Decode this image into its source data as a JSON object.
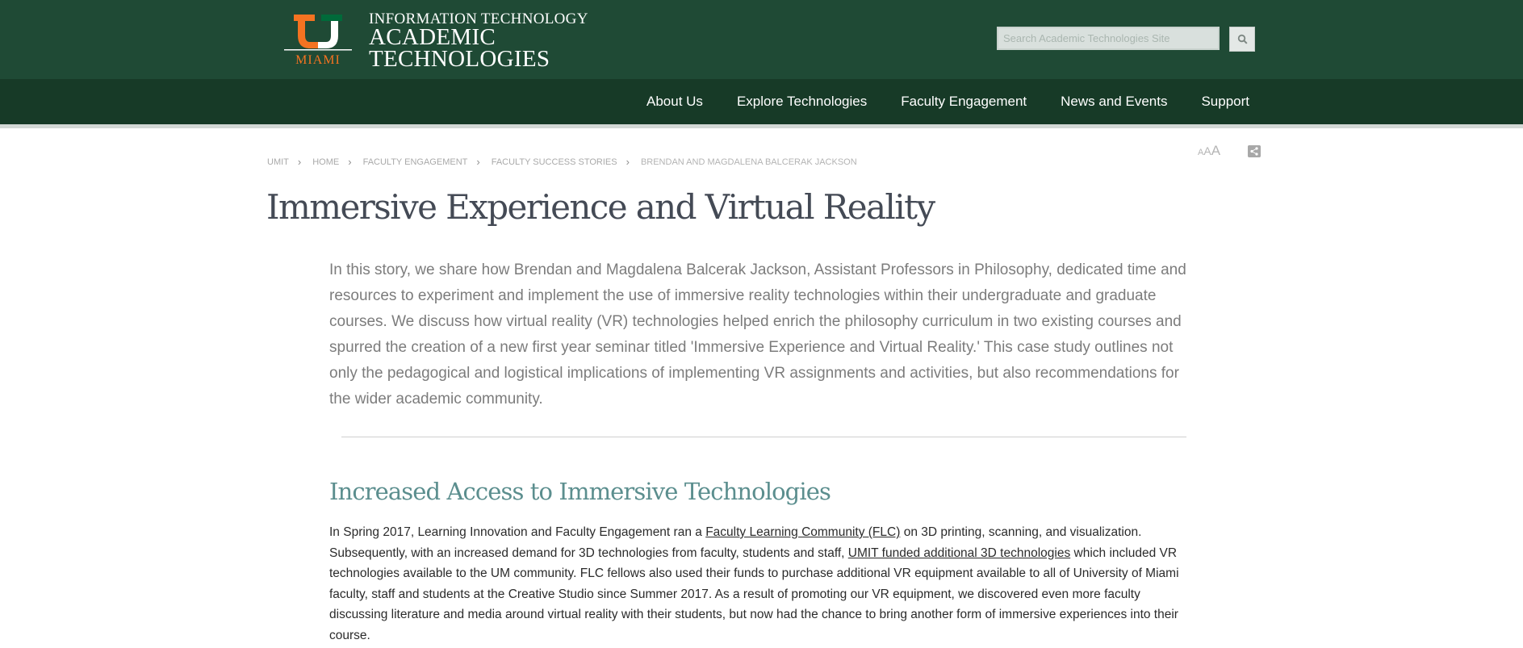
{
  "header": {
    "logo_text": "MIAMI",
    "brand_line1": "INFORMATION TECHNOLOGY",
    "brand_line2": "ACADEMIC",
    "brand_line3": "TECHNOLOGIES",
    "search_placeholder": "Search Academic Technologies Site",
    "colors": {
      "header_bg": "#1f4a35",
      "nav_bg": "#173a27",
      "logo_orange": "#f47321",
      "logo_green": "#006a3a"
    }
  },
  "nav": {
    "items": [
      {
        "label": "About Us"
      },
      {
        "label": "Explore Technologies"
      },
      {
        "label": "Faculty Engagement"
      },
      {
        "label": "News and Events"
      },
      {
        "label": "Support"
      }
    ]
  },
  "breadcrumb": {
    "items": [
      {
        "label": "UMIT"
      },
      {
        "label": "HOME"
      },
      {
        "label": "FACULTY ENGAGEMENT"
      },
      {
        "label": "FACULTY SUCCESS STORIES"
      }
    ],
    "current": "BRENDAN AND MAGDALENA BALCERAK JACKSON"
  },
  "tools": {
    "text_size_label_small": "A",
    "text_size_label_mid": "A",
    "text_size_label_large": "A",
    "share_icon": "share-icon"
  },
  "page": {
    "title": "Immersive Experience and Virtual Reality",
    "intro": "In this story, we share how Brendan and Magdalena Balcerak Jackson, Assistant Professors in Philosophy, dedicated time and resources to experiment and implement the use of immersive reality technologies within their undergraduate and graduate courses. We discuss how virtual reality (VR) technologies helped enrich the philosophy curriculum in two existing courses and spurred the creation of a new first year seminar titled 'Immersive Experience and Virtual Reality.' This case study outlines not only the pedagogical and logistical implications of implementing VR assignments and activities, but also recommendations for the wider academic community."
  },
  "section": {
    "title": "Increased Access to Immersive Technologies",
    "p1": "In Spring 2017, Learning Innovation and Faculty Engagement ran a ",
    "link1": "Faculty Learning Community (FLC)",
    "p2": " on 3D printing, scanning, and visualization. Subsequently, with an increased demand for 3D technologies from faculty, students and staff, ",
    "link2": "UMIT funded additional 3D technologies",
    "p3": " which included VR technologies available to the UM community. FLC fellows also used their funds to purchase additional VR equipment available to all of University of Miami faculty, staff and students at the Creative Studio since Summer 2017. As a result of promoting our VR equipment, we discovered even more faculty discussing literature and media around virtual reality with their students, but now had the chance to bring another form of immersive experiences into their course."
  }
}
